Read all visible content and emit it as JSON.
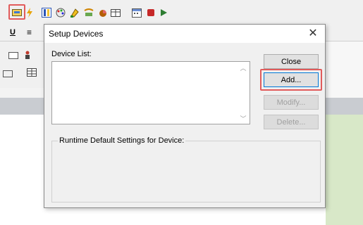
{
  "dialog": {
    "title": "Setup Devices",
    "close_glyph": "✕",
    "device_list_label": "Device List:",
    "device_list_items": [],
    "runtime_group_label": "Runtime Default Settings for Device:",
    "buttons": {
      "close": "Close",
      "add": "Add...",
      "modify": "Modify...",
      "delete": "Delete..."
    },
    "scroll_up_glyph": "︿",
    "scroll_down_glyph": "﹀"
  },
  "background": {
    "row2_glyphs": [
      "U",
      "≡"
    ],
    "highlight_color": "#e15b5b",
    "toolbar_icons": [
      "device-setup-icon",
      "lightning-icon",
      "columns-icon",
      "palette-icon",
      "paint-icon",
      "tools-icon",
      "pie-icon",
      "table-icon",
      "calendar-icon",
      "stop-icon",
      "play-icon"
    ]
  }
}
